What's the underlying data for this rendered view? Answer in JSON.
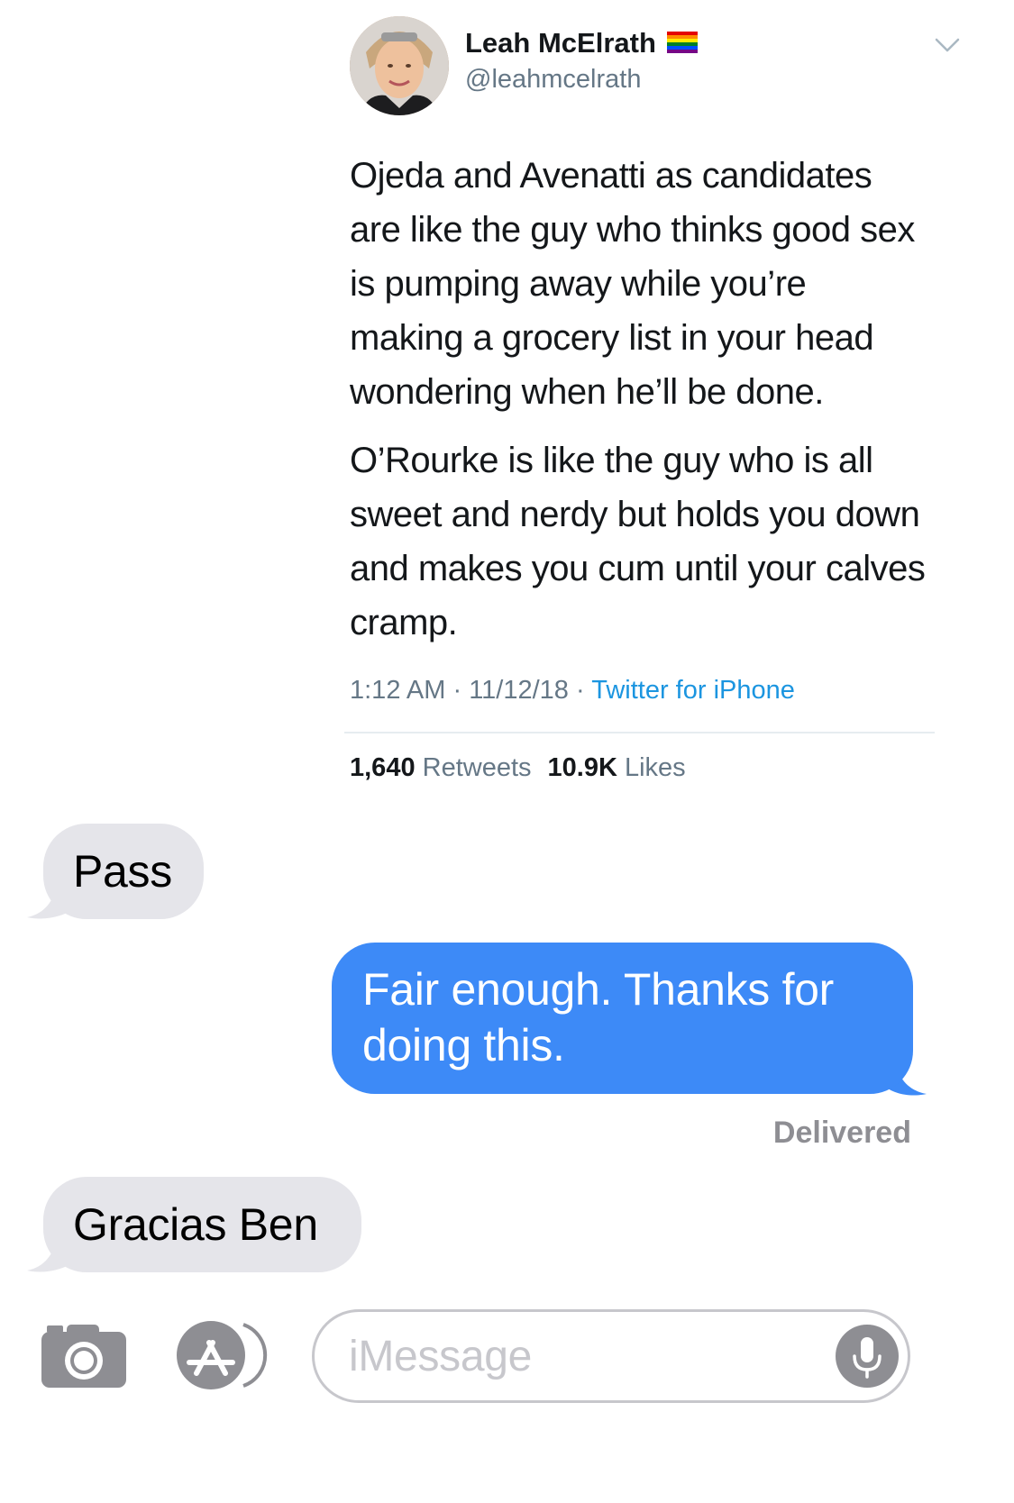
{
  "tweet": {
    "author_name": "Leah McElrath",
    "author_handle": "@leahmcelrath",
    "flag_icon": "rainbow-flag-icon",
    "menu_icon": "chevron-down-icon",
    "paragraphs": [
      "Ojeda and Avenatti as candidates\nare like the guy who thinks good sex\nis pumping away while you’re\nmaking a grocery list in your head\nwondering when he’ll be done.",
      "O’Rourke is like the guy who is all\nsweet and nerdy but holds you down\nand makes you cum until your calves\ncramp."
    ],
    "time": "1:12 AM",
    "separator": "·",
    "date": "11/12/18",
    "source": "Twitter for iPhone",
    "retweets_count": "1,640",
    "retweets_label": "Retweets",
    "likes_count": "10.9K",
    "likes_label": "Likes"
  },
  "messages": [
    {
      "direction": "incoming",
      "text": "Pass"
    },
    {
      "direction": "outgoing",
      "text": "Fair enough. Thanks for\ndoing this."
    },
    {
      "direction": "incoming",
      "text": "Gracias Ben"
    }
  ],
  "status": {
    "delivered": "Delivered"
  },
  "input_bar": {
    "camera_icon": "camera-icon",
    "apps_icon": "app-store-icon",
    "placeholder": "iMessage",
    "mic_icon": "microphone-icon"
  },
  "colors": {
    "incoming_bubble": "#e5e5ea",
    "outgoing_bubble": "#3d8af7",
    "link_blue": "#1b95e0",
    "secondary_gray": "#657786"
  }
}
